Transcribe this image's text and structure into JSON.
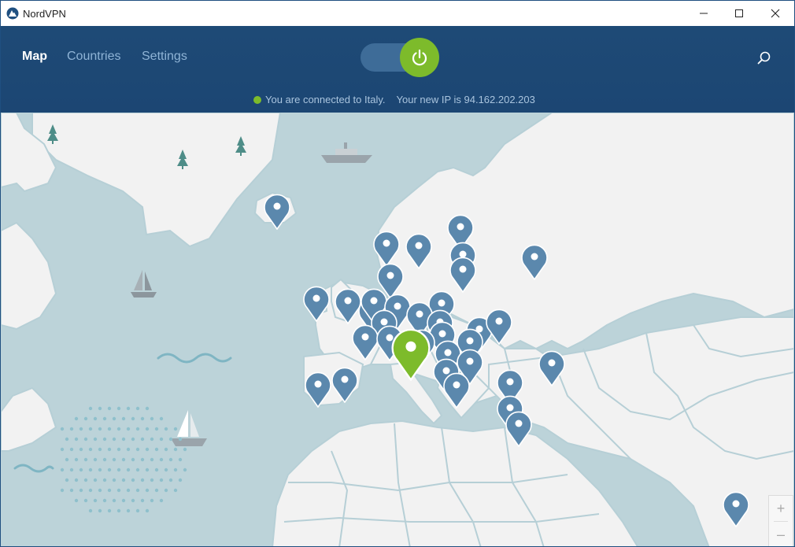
{
  "window": {
    "title": "NordVPN"
  },
  "nav": {
    "tabs": [
      {
        "label": "Map"
      },
      {
        "label": "Countries"
      },
      {
        "label": "Settings"
      }
    ]
  },
  "connection": {
    "connected": true,
    "status_text": "You are connected to Italy.",
    "ip_text": "Your new IP is 94.162.202.203"
  },
  "map_controls": {
    "zoom_in": "+",
    "zoom_out": "–"
  },
  "colors": {
    "header": "#1e4a76",
    "accent_green": "#7dbb2b",
    "pin_blue": "#5b88ad",
    "sea": "#bcd3d9",
    "land": "#f2f2f2"
  },
  "icons": {
    "app": "nordvpn-logo-icon",
    "power": "power-icon",
    "search": "search-icon",
    "pin": "map-pin-icon"
  }
}
